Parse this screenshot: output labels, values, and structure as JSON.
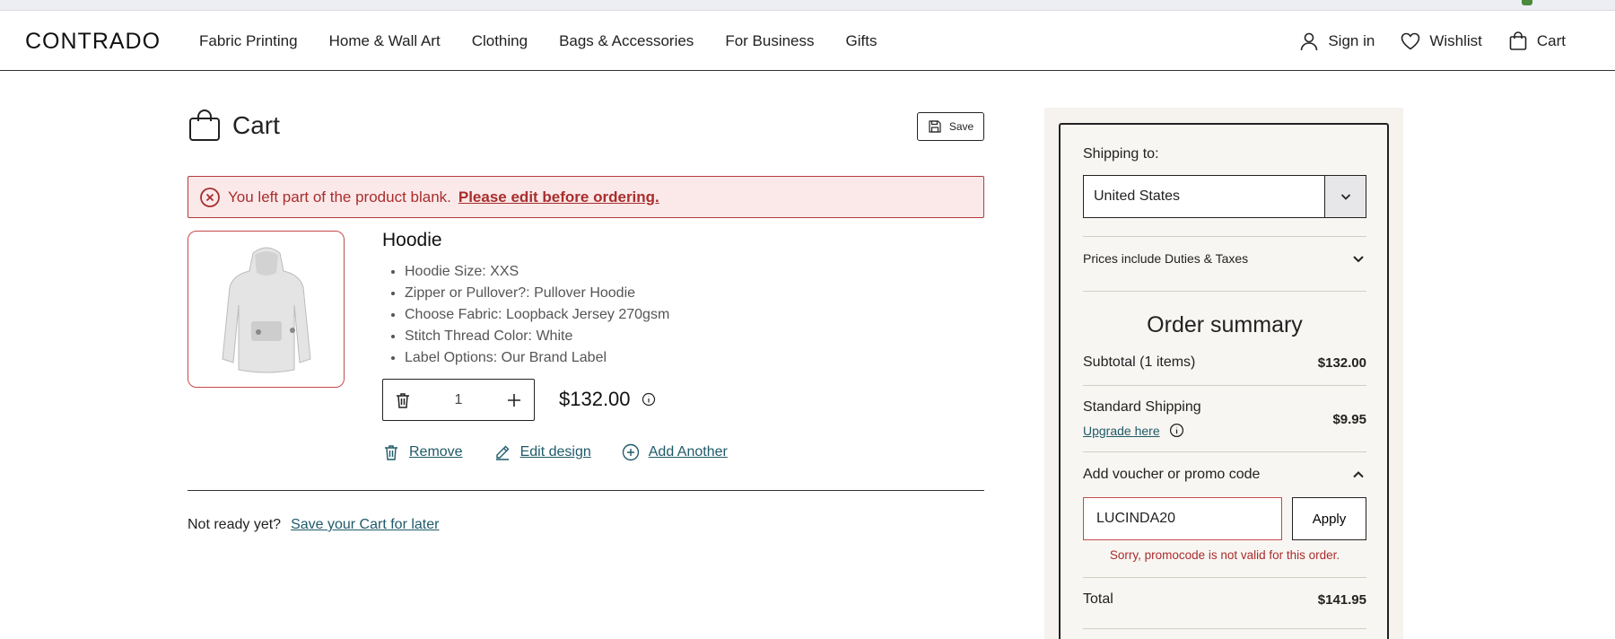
{
  "header": {
    "logo": "CONTRADO",
    "nav": [
      "Fabric Printing",
      "Home & Wall Art",
      "Clothing",
      "Bags & Accessories",
      "For Business",
      "Gifts"
    ],
    "sign_in": "Sign in",
    "wishlist": "Wishlist",
    "cart": "Cart"
  },
  "cart": {
    "title": "Cart",
    "save_label": "Save",
    "error_text": "You left part of the product blank.",
    "error_link": "Please edit before ordering.",
    "product": {
      "name": "Hoodie",
      "options": [
        "Hoodie Size: XXS",
        "Zipper or Pullover?: Pullover Hoodie",
        "Choose Fabric: Loopback Jersey 270gsm",
        "Stitch Thread Color: White",
        "Label Options: Our Brand Label"
      ],
      "quantity": "1",
      "price": "$132.00"
    },
    "actions": {
      "remove": "Remove",
      "edit": "Edit design",
      "add": "Add Another"
    },
    "later_text": "Not ready yet?",
    "later_link": "Save your Cart for later"
  },
  "summary": {
    "shipping_to_label": "Shipping to:",
    "country": "United States",
    "duties_label": "Prices include Duties & Taxes",
    "title": "Order summary",
    "subtotal_label": "Subtotal (1 items)",
    "subtotal_value": "$132.00",
    "shipping_label": "Standard Shipping",
    "shipping_value": "$9.95",
    "upgrade_label": "Upgrade here",
    "voucher_label": "Add voucher or promo code",
    "promo_value": "LUCINDA20",
    "apply_label": "Apply",
    "promo_error": "Sorry, promocode is not valid for this order.",
    "total_label": "Total",
    "total_value": "$141.95"
  }
}
